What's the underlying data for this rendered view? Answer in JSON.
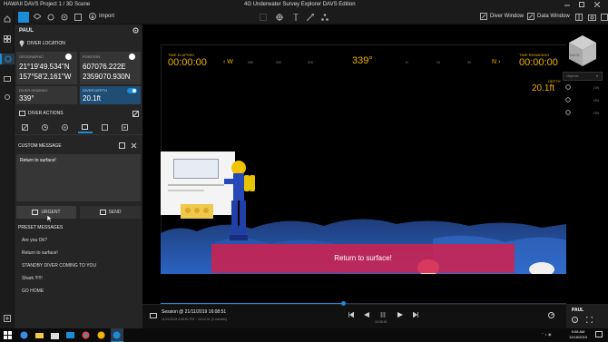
{
  "window": {
    "title": "HAWAII DAVS Project 1 / 3D Scene",
    "app_title": "4G Underwater Survey Explorer DAVS Edition"
  },
  "toolbar": {
    "import_label": "Import",
    "diver_window_label": "Diver Window",
    "data_window_label": "Data Window"
  },
  "panel": {
    "diver_name": "PAUL",
    "diver_location_label": "DIVER LOCATION",
    "geographic": {
      "label": "GEOGRAPHIC",
      "lat": "21°19'49.534\"N",
      "lon": "157°58'2.161\"W"
    },
    "position": {
      "label": "POSITION",
      "easting": "607076.222E",
      "northing": "2359070.930N"
    },
    "heading": {
      "label": "DIVER HEADING",
      "value": "339°"
    },
    "depth": {
      "label": "DIVER DEPTH",
      "value": "20.1ft"
    },
    "diver_actions_label": "DIVER ACTIONS",
    "custom_message_label": "CUSTOM MESSAGE",
    "message_text": "Return to surface!",
    "urgent_label": "URGENT",
    "send_label": "SEND",
    "preset_messages_label": "PRESET MESSAGES",
    "presets": [
      "Are you Ok?",
      "Return to surface!",
      "STANDBY DIVER COMING TO YOU",
      "Shark !!!!!!",
      "GO HOME"
    ]
  },
  "hud": {
    "time_elapsed_label": "TIME ELAPSED",
    "time_elapsed": "00:00:00",
    "time_remaining_label": "TIME REMAINING",
    "time_remaining": "00:00:00",
    "compass_left": "‹ W",
    "compass_right": "N ›",
    "heading": "339°",
    "ticks": [
      "255",
      "300",
      "315",
      "N",
      "15",
      "30"
    ],
    "depth_label": "DEPTH",
    "depth": "20.1ft",
    "banner": "Return to surface!",
    "cube_label": "BACK",
    "side_dropdown": "Objects",
    "side_items": [
      "ON",
      "ON",
      "ON"
    ]
  },
  "playback": {
    "session": "Session @ 21/11/2019 16:08:51",
    "session_sub": "11/21/2019 4:08:51 PM ~ 04:12:51 (3 minutes)",
    "time_mid": "16:08:51",
    "progress": 0.45,
    "user": "PAUL"
  },
  "taskbar": {
    "time": "9:08 AM",
    "date": "12/18/2019"
  },
  "colors": {
    "accent": "#1a8cd8",
    "hud_amber": "#f0b400",
    "banner": "#d4204c",
    "card_selected": "#1f4d73"
  }
}
